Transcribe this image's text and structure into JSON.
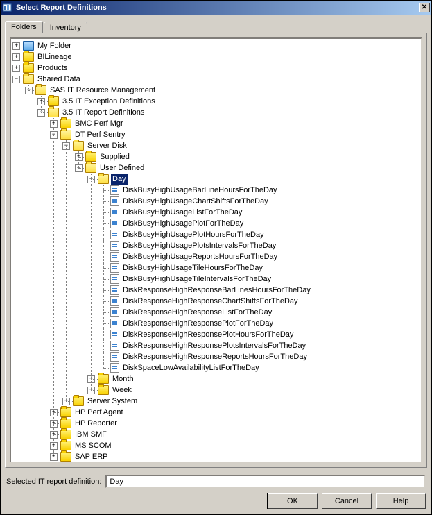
{
  "window": {
    "title": "Select Report Definitions"
  },
  "tabs": {
    "folders": "Folders",
    "inventory": "Inventory"
  },
  "tree": {
    "my_folder": "My Folder",
    "bilineage": "BILineage",
    "products": "Products",
    "shared_data": "Shared Data",
    "sas_itrm": "SAS IT Resource Management",
    "excep_defs": "3.5 IT Exception Definitions",
    "report_defs": "3.5 IT Report Definitions",
    "bmc": "BMC Perf Mgr",
    "dt": "DT Perf Sentry",
    "server_disk": "Server Disk",
    "supplied": "Supplied",
    "user_defined": "User Defined",
    "day": "Day",
    "month": "Month",
    "week": "Week",
    "server_system": "Server System",
    "hp_agent": "HP Perf Agent",
    "hp_reporter": "HP Reporter",
    "ibm_smf": "IBM SMF",
    "ms_scom": "MS SCOM",
    "sap_erp": "SAP ERP",
    "reports": [
      "DiskBusyHighUsageBarLineHoursForTheDay",
      "DiskBusyHighUsageChartShiftsForTheDay",
      "DiskBusyHighUsageListForTheDay",
      "DiskBusyHighUsagePlotForTheDay",
      "DiskBusyHighUsagePlotHoursForTheDay",
      "DiskBusyHighUsagePlotsIntervalsForTheDay",
      "DiskBusyHighUsageReportsHoursForTheDay",
      "DiskBusyHighUsageTileHoursForTheDay",
      "DiskBusyHighUsageTileIntervalsForTheDay",
      "DiskResponseHighResponseBarLinesHoursForTheDay",
      "DiskResponseHighResponseChartShiftsForTheDay",
      "DiskResponseHighResponseListForTheDay",
      "DiskResponseHighResponsePlotForTheDay",
      "DiskResponseHighResponsePlotHoursForTheDay",
      "DiskResponseHighResponsePlotsIntervalsForTheDay",
      "DiskResponseHighResponseReportsHoursForTheDay",
      "DiskSpaceLowAvailabilityListForTheDay"
    ]
  },
  "footer": {
    "label": "Selected IT report definition:",
    "value": "Day",
    "ok": "OK",
    "cancel": "Cancel",
    "help": "Help"
  }
}
